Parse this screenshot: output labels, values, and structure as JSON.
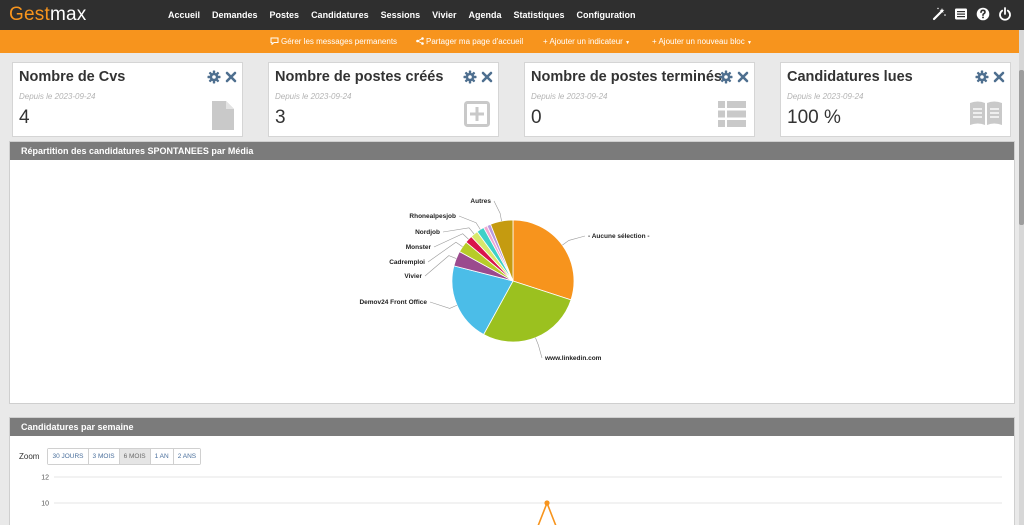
{
  "app": {
    "logo_part1": "Gest",
    "logo_part2": "max",
    "nav": [
      "Accueil",
      "Demandes",
      "Postes",
      "Candidatures",
      "Sessions",
      "Vivier",
      "Agenda",
      "Statistiques",
      "Configuration"
    ],
    "active_nav": 0,
    "top_icons": [
      "magic-wand-icon",
      "news-icon",
      "help-icon",
      "power-icon"
    ]
  },
  "toolbar": {
    "manage_messages": "Gérer les messages permanents",
    "share_home": "Partager ma page d'accueil",
    "add_indicator": "+ Ajouter un indicateur",
    "add_block": "+ Ajouter un nouveau bloc"
  },
  "cards": [
    {
      "title": "Nombre de Cvs",
      "date": "Depuis le 2023-09-24",
      "value": "4",
      "icon": "file-icon"
    },
    {
      "title": "Nombre de postes créés",
      "date": "Depuis le 2023-09-24",
      "value": "3",
      "icon": "plus-square-icon"
    },
    {
      "title": "Nombre de postes terminés",
      "date": "Depuis le 2023-09-24",
      "value": "0",
      "icon": "table-list-icon"
    },
    {
      "title": "Candidatures lues",
      "date": "Depuis le 2023-09-24",
      "value": "100 %",
      "icon": "open-book-icon"
    }
  ],
  "panel_pie": {
    "title": "Répartition des candidatures SPONTANEES par Média"
  },
  "panel_line": {
    "title": "Candidatures par semaine",
    "zoom_label": "Zoom",
    "zoom_buttons": [
      "30 JOURS",
      "3 MOIS",
      "6 MOIS",
      "1 AN",
      "2 ANS"
    ],
    "active_zoom": 2
  },
  "colors": {
    "brand_orange": "#f7941d",
    "nav_dark": "#2f2f2f",
    "panel_header": "#7b7b7b"
  },
  "chart_data": [
    {
      "type": "pie",
      "title": "Répartition des candidatures SPONTANEES par Média",
      "categories": [
        "- Aucune sélection -",
        "www.linkedin.com",
        "Demov24 Front Office",
        "Vivier",
        "Cadremploi",
        "Monster",
        "Nordjob",
        "Rhonealpesjob",
        "",
        "",
        "Autres"
      ],
      "values": [
        30,
        28,
        21,
        4,
        3,
        2,
        2,
        2,
        1,
        1,
        6
      ],
      "colors": [
        "#f7941d",
        "#9bc11f",
        "#4bbde8",
        "#9b4a8e",
        "#b7cc28",
        "#d9154b",
        "#d8e86c",
        "#3dd0c8",
        "#f1a8d0",
        "#b89be0",
        "#c59b10"
      ]
    },
    {
      "type": "line",
      "title": "Candidatures par semaine",
      "y_ticks": [
        12,
        10
      ],
      "series": [
        {
          "values": [
            10
          ]
        }
      ]
    }
  ]
}
